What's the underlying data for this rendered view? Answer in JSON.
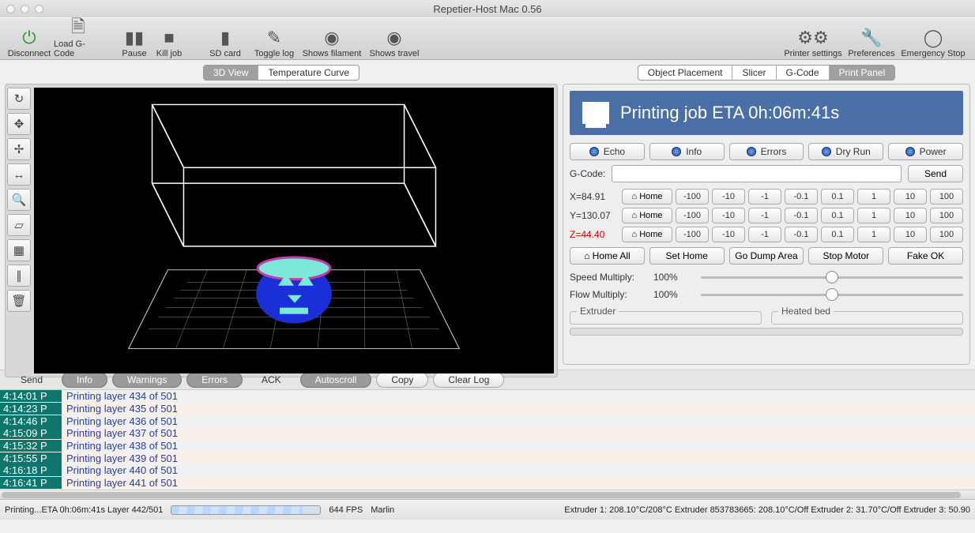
{
  "window": {
    "title": "Repetier-Host Mac 0.56"
  },
  "toolbar": {
    "disconnect": "Disconnect",
    "load_gcode": "Load G-Code",
    "pause": "Pause",
    "kill_job": "Kill job",
    "sd_card": "SD card",
    "toggle_log": "Toggle log",
    "shows_filament": "Shows filament",
    "shows_travel": "Shows travel",
    "printer_settings": "Printer settings",
    "preferences": "Preferences",
    "emergency_stop": "Emergency Stop"
  },
  "left_tabs": {
    "view3d": "3D View",
    "temp_curve": "Temperature Curve"
  },
  "right_tabs": {
    "object_placement": "Object Placement",
    "slicer": "Slicer",
    "gcode": "G-Code",
    "print_panel": "Print Panel"
  },
  "panel": {
    "eta_text": "Printing job ETA 0h:06m:41s",
    "toggles": {
      "echo": "Echo",
      "info": "Info",
      "errors": "Errors",
      "dry_run": "Dry Run",
      "power": "Power"
    },
    "gcode_label": "G-Code:",
    "gcode_value": "",
    "send_label": "Send",
    "axes": {
      "x": {
        "label": "X=84.91",
        "home": "Home"
      },
      "y": {
        "label": "Y=130.07",
        "home": "Home"
      },
      "z": {
        "label": "Z=44.40",
        "home": "Home"
      },
      "jog": [
        "-100",
        "-10",
        "-1",
        "-0.1",
        "0.1",
        "1",
        "10",
        "100"
      ]
    },
    "actions": {
      "home_all": "Home All",
      "set_home": "Set Home",
      "go_dump": "Go Dump Area",
      "stop_motor": "Stop Motor",
      "fake_ok": "Fake OK"
    },
    "sliders": {
      "speed_label": "Speed Multiply:",
      "speed_value": "100%",
      "flow_label": "Flow Multiply:",
      "flow_value": "100%"
    },
    "sub": {
      "extruder": "Extruder",
      "heated_bed": "Heated bed"
    }
  },
  "logbar": {
    "send": "Send",
    "info": "Info",
    "warnings": "Warnings",
    "errors": "Errors",
    "ack": "ACK",
    "autoscroll": "Autoscroll",
    "copy": "Copy",
    "clear_log": "Clear Log"
  },
  "log": [
    {
      "ts": "4:14:01 P",
      "msg": "Printing layer 434 of 501"
    },
    {
      "ts": "4:14:23 P",
      "msg": "Printing layer 435 of 501"
    },
    {
      "ts": "4:14:46 P",
      "msg": "Printing layer 436 of 501"
    },
    {
      "ts": "4:15:09 P",
      "msg": "Printing layer 437 of 501"
    },
    {
      "ts": "4:15:32 P",
      "msg": "Printing layer 438 of 501"
    },
    {
      "ts": "4:15:55 P",
      "msg": "Printing layer 439 of 501"
    },
    {
      "ts": "4:16:18 P",
      "msg": "Printing layer 440 of 501"
    },
    {
      "ts": "4:16:41 P",
      "msg": "Printing layer 441 of 501"
    }
  ],
  "status": {
    "left": "Printing...ETA 0h:06m:41s Layer 442/501",
    "fps": "644 FPS",
    "firmware": "Marlin",
    "temps": "Extruder 1: 208.10°C/208°C Extruder 853783665: 208.10°C/Off Extruder 2: 31.70°C/Off Extruder 3: 50.90"
  },
  "icons": {
    "home": "⌂"
  }
}
